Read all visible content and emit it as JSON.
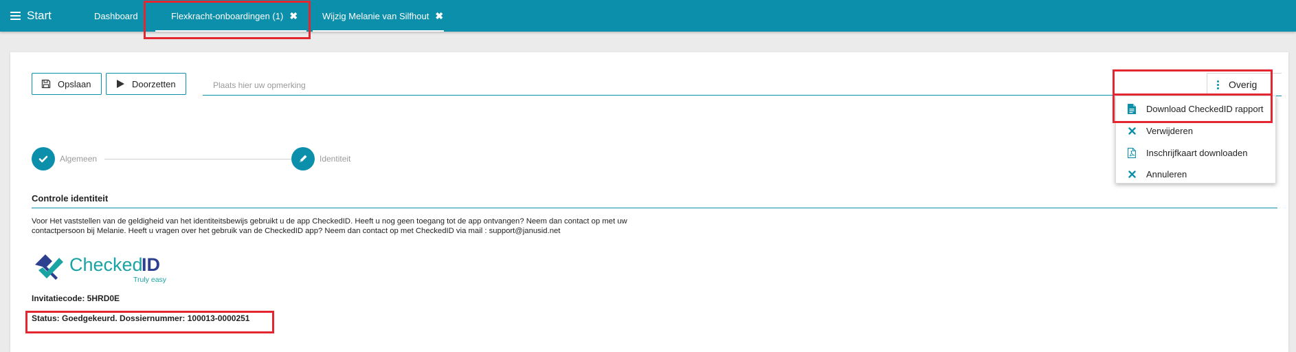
{
  "topbar": {
    "start_label": "Start",
    "tabs": [
      {
        "label": "Dashboard",
        "closable": false,
        "active": false
      },
      {
        "label": "Flexkracht-onboardingen (1)",
        "closable": true,
        "active": true
      },
      {
        "label": "Wijzig Melanie van Silfhout",
        "closable": true,
        "active": true
      }
    ],
    "close_glyph": "✖"
  },
  "toolbar": {
    "save_label": "Opslaan",
    "forward_label": "Doorzetten",
    "remark_placeholder": "Plaats hier uw opmerking",
    "more_label": "Overig"
  },
  "menu": {
    "items": [
      {
        "label": "Download CheckedID rapport",
        "icon": "document-icon"
      },
      {
        "label": "Verwijderen",
        "icon": "close-icon"
      },
      {
        "label": "Inschrijfkaart downloaden",
        "icon": "pdf-icon"
      },
      {
        "label": "Annuleren",
        "icon": "close-icon"
      }
    ]
  },
  "stepper": {
    "steps": [
      {
        "label": "Algemeen",
        "icon": "check-icon",
        "state": "done"
      },
      {
        "label": "Identiteit",
        "icon": "pencil-icon",
        "state": "current"
      }
    ]
  },
  "content": {
    "section_title": "Controle identiteit",
    "description": "Voor Het vaststellen van de geldigheid van het identiteitsbewijs gebruikt u de app CheckedID. Heeft u nog geen toegang tot de app ontvangen? Neem dan contact op met uw contactpersoon bij Melanie. Heeft u vragen over het gebruik van de CheckedID app? Neem dan contact op met CheckedID via mail : support@janusid.net",
    "logo": {
      "word1": "Checked",
      "word2": "ID",
      "tagline": "Truly easy"
    },
    "invitation": "Invitatiecode: 5HRD0E",
    "status": "Status: Goedgekeurd. Dossiernummer: 100013-0000251"
  },
  "colors": {
    "accent": "#0c8fab",
    "highlight": "#e3262f",
    "logo_teal": "#1aa3a3",
    "logo_navy": "#2d3f8f"
  }
}
